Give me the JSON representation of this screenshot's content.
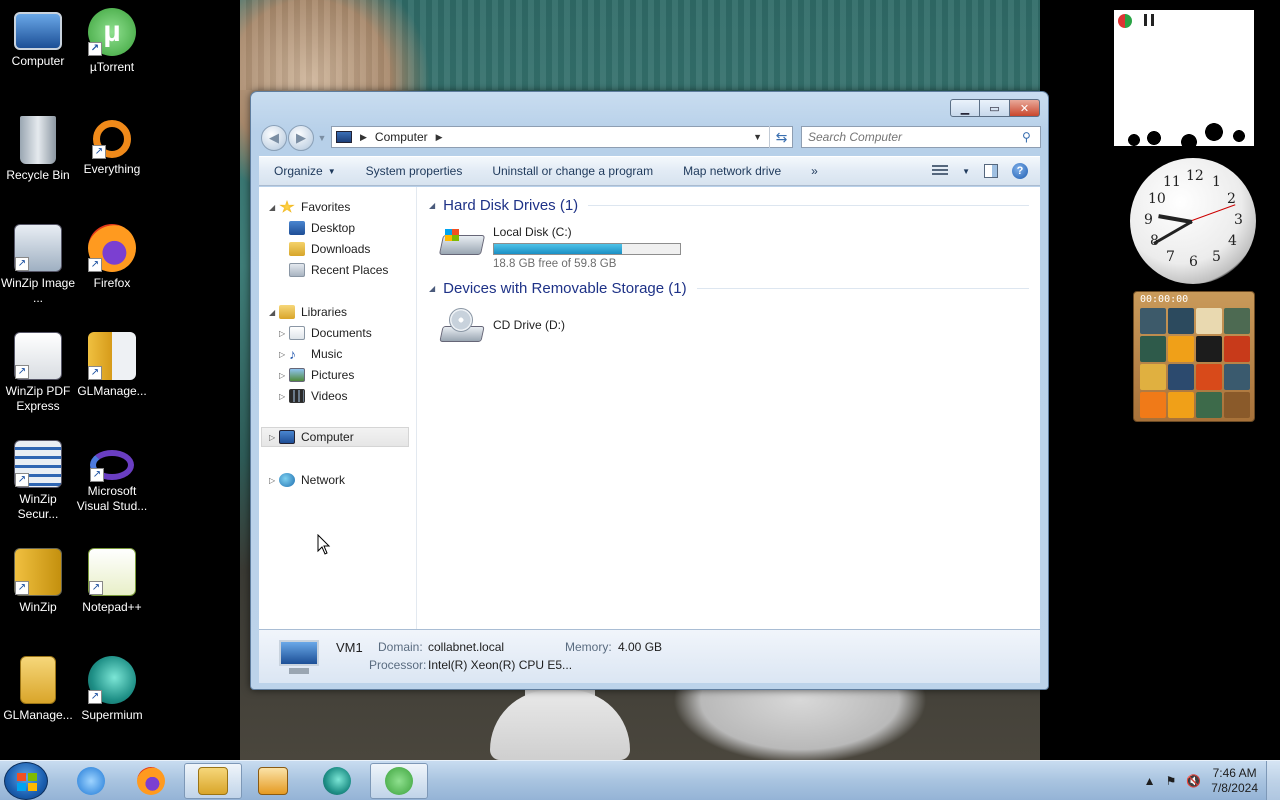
{
  "desktop": {
    "icons": [
      {
        "label": "Computer",
        "icon": "computer-icon"
      },
      {
        "label": "µTorrent",
        "icon": "utorrent-icon"
      },
      {
        "label": "Recycle Bin",
        "icon": "recycle-bin-icon"
      },
      {
        "label": "Everything",
        "icon": "everything-icon"
      },
      {
        "label": "WinZip Image ...",
        "icon": "winzip-image-icon"
      },
      {
        "label": "Firefox",
        "icon": "firefox-icon"
      },
      {
        "label": "WinZip PDF Express",
        "icon": "winzip-pdf-icon"
      },
      {
        "label": "GLManage...",
        "icon": "glmanager-icon"
      },
      {
        "label": "WinZip Secur...",
        "icon": "winzip-secure-icon"
      },
      {
        "label": "Microsoft Visual Stud...",
        "icon": "visual-studio-icon"
      },
      {
        "label": "WinZip",
        "icon": "winzip-icon"
      },
      {
        "label": "Notepad++",
        "icon": "notepadpp-icon"
      },
      {
        "label": "GLManage...",
        "icon": "glmanager-folder-icon"
      },
      {
        "label": "Supermium",
        "icon": "supermium-icon"
      }
    ]
  },
  "gadgets": {
    "puzzle_timer": "00:00:00",
    "clock_numbers": [
      "12",
      "1",
      "2",
      "3",
      "4",
      "5",
      "6",
      "7",
      "8",
      "9",
      "10",
      "11"
    ]
  },
  "explorer": {
    "address": {
      "location": "Computer"
    },
    "search": {
      "placeholder": "Search Computer"
    },
    "toolbar": {
      "organize": "Organize",
      "system_properties": "System properties",
      "uninstall": "Uninstall or change a program",
      "map_drive": "Map network drive",
      "more": "»"
    },
    "navpane": {
      "favorites": "Favorites",
      "desktop": "Desktop",
      "downloads": "Downloads",
      "recent_places": "Recent Places",
      "libraries": "Libraries",
      "documents": "Documents",
      "music": "Music",
      "pictures": "Pictures",
      "videos": "Videos",
      "computer": "Computer",
      "network": "Network"
    },
    "groups": {
      "hdd": "Hard Disk Drives (1)",
      "removable": "Devices with Removable Storage (1)"
    },
    "drives": {
      "c": {
        "name": "Local Disk (C:)",
        "free_text": "18.8 GB free of 59.8 GB",
        "used_fraction": 0.686
      },
      "d": {
        "name": "CD Drive (D:)"
      }
    },
    "details": {
      "name": "VM1",
      "domain_label": "Domain:",
      "domain_value": "collabnet.local",
      "memory_label": "Memory:",
      "memory_value": "4.00 GB",
      "processor_label": "Processor:",
      "processor_value": "Intel(R) Xeon(R) CPU E5..."
    }
  },
  "taskbar": {
    "apps": [
      "start-button",
      "internet-explorer",
      "firefox",
      "windows-explorer",
      "media-player",
      "supermium",
      "utorrent"
    ],
    "time": "7:46 AM",
    "date": "7/8/2024"
  }
}
